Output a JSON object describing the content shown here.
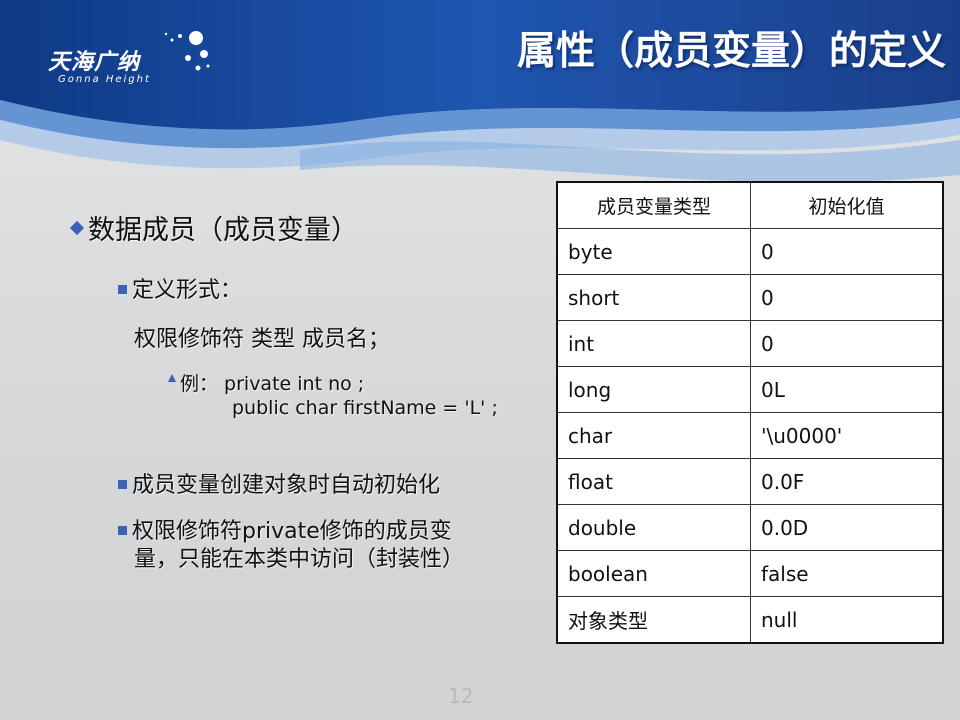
{
  "logo": {
    "name": "天海广纳",
    "subtitle": "Gonna Height"
  },
  "title": "属性（成员变量）的定义",
  "bullets": {
    "main": "数据成员（成员变量）",
    "define": "定义形式：",
    "syntax": "权限修饰符  类型  成员名；",
    "example_line1": "例：  private int no ;",
    "example_line2": "public  char firstName = 'L' ;",
    "auto_init": "成员变量创建对象时自动初始化",
    "private_line1": "权限修饰符private修饰的成员变",
    "private_line2": "量，只能在本类中访问（封装性）"
  },
  "table": {
    "headers": [
      "成员变量类型",
      "初始化值"
    ],
    "rows": [
      [
        "byte",
        "0"
      ],
      [
        "short",
        "0"
      ],
      [
        "int",
        "0"
      ],
      [
        "long",
        "0L"
      ],
      [
        "char",
        "'\\u0000'"
      ],
      [
        "float",
        "0.0F"
      ],
      [
        "double",
        "0.0D"
      ],
      [
        "boolean",
        "false"
      ],
      [
        "对象类型",
        "null"
      ]
    ]
  },
  "page_number": "12",
  "colors": {
    "header_blue": "#1e4d9c",
    "bullet_blue": "#3a62b5",
    "background": "#d9dadc"
  }
}
